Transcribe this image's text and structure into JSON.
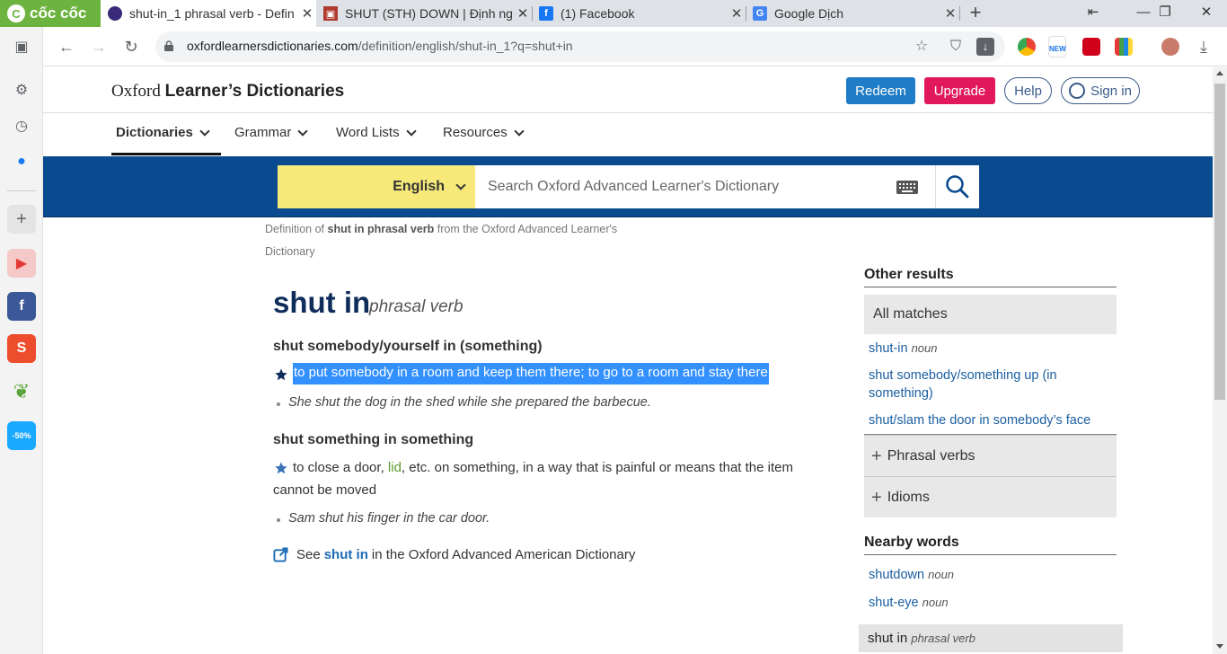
{
  "browser": {
    "brand": "cốc cốc",
    "tabs": [
      {
        "title": "shut-in_1 phrasal verb - Defin",
        "active": true
      },
      {
        "title": "SHUT (STH) DOWN | Định ngh",
        "active": false
      },
      {
        "title": "(1) Facebook",
        "active": false
      },
      {
        "title": "Google Dịch",
        "active": false
      }
    ],
    "url_domain": "oxfordlearnersdictionaries.com",
    "url_path": "/definition/english/shut-in_1?q=shut+in"
  },
  "header": {
    "brand_serif": "Oxford",
    "brand_sans": "Learner’s Dictionaries",
    "redeem": "Redeem",
    "upgrade": "Upgrade",
    "help": "Help",
    "signin": "Sign in"
  },
  "nav": {
    "items": [
      "Dictionaries",
      "Grammar",
      "Word Lists",
      "Resources"
    ]
  },
  "search": {
    "language": "English",
    "placeholder": "Search Oxford Advanced Learner's Dictionary"
  },
  "entry": {
    "definition_of_prefix": "Definition of",
    "definition_of_term": "shut in phrasal verb",
    "definition_of_suffix": "from the Oxford Advanced Learner's Dictionary",
    "headword": "shut in",
    "pos": "phrasal verb",
    "senses": [
      {
        "heading": "shut somebody/yourself in (something)",
        "definition": "to put somebody in a room and keep them there; to go to a room and stay there",
        "example": "She shut the dog in the shed while she prepared the barbecue."
      },
      {
        "heading": "shut something in something",
        "definition_before": "to close a door,",
        "definition_link": "lid",
        "definition_after": ", etc. on something, in a way that is painful or means that the item cannot be moved",
        "example": "Sam shut his finger in the car door."
      }
    ],
    "see_prefix": "See",
    "see_link": "shut in",
    "see_suffix": "in the Oxford Advanced American Dictionary"
  },
  "sidebar": {
    "other_results_heading": "Other results",
    "all_matches": "All matches",
    "matches": [
      {
        "word": "shut-in",
        "pos": "noun"
      },
      {
        "word": "shut somebody/something up (in something)",
        "pos": ""
      },
      {
        "word": "shut/slam the door in somebody’s face",
        "pos": ""
      }
    ],
    "phrasal_verbs": "Phrasal verbs",
    "idioms": "Idioms",
    "nearby_heading": "Nearby words",
    "nearby": [
      {
        "word": "shutdown",
        "pos": "noun"
      },
      {
        "word": "shut-eye",
        "pos": "noun"
      }
    ],
    "nearby_current": {
      "word": "shut in",
      "pos": "phrasal verb"
    }
  },
  "colors": {
    "band": "#0a4a8f",
    "lang_select": "#f6e97a",
    "redeem": "#1f7cc7",
    "upgrade": "#e2185c",
    "selection": "#3390ff",
    "headword": "#0f2d5a"
  }
}
